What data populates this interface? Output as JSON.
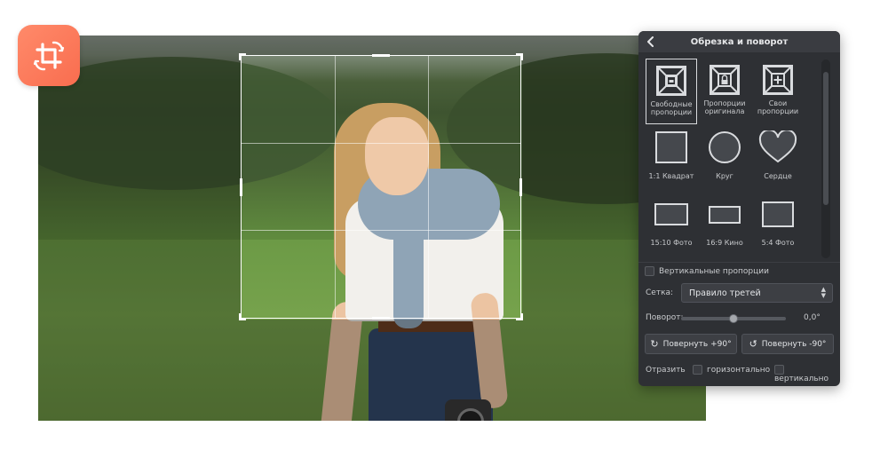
{
  "panel": {
    "title": "Обрезка и поворот",
    "shapes": [
      {
        "label": "Свободные пропорции",
        "icon": "free-proportions-icon",
        "selected": true
      },
      {
        "label": "Пропорции оригинала",
        "icon": "original-proportions-icon",
        "selected": false
      },
      {
        "label": "Свои пропорции",
        "icon": "custom-proportions-icon",
        "selected": false
      },
      {
        "label": "1:1 Квадрат",
        "icon": "square-icon",
        "selected": false
      },
      {
        "label": "Круг",
        "icon": "circle-icon",
        "selected": false
      },
      {
        "label": "Сердце",
        "icon": "heart-icon",
        "selected": false
      },
      {
        "label": "15:10 Фото",
        "icon": "rect-15-10-icon",
        "selected": false
      },
      {
        "label": "16:9 Кино",
        "icon": "rect-16-9-icon",
        "selected": false
      },
      {
        "label": "5:4 Фото",
        "icon": "rect-5-4-icon",
        "selected": false
      }
    ],
    "vertical_proportions": {
      "label": "Вертикальные пропорции",
      "checked": false
    },
    "grid": {
      "label": "Сетка:",
      "value": "Правило третей"
    },
    "rotation": {
      "label": "Поворот:",
      "value": "0,0°",
      "level": 0.5
    },
    "rotate_plus": "Повернуть +90°",
    "rotate_minus": "Повернуть -90°",
    "flip": {
      "label": "Отразить",
      "horizontal": "горизонтально",
      "vertical": "вертикально"
    }
  },
  "colors": {
    "accent": "#f96d4f",
    "panel_bg": "#2e3034"
  },
  "app_badge_icon": "crop-rotate-icon"
}
